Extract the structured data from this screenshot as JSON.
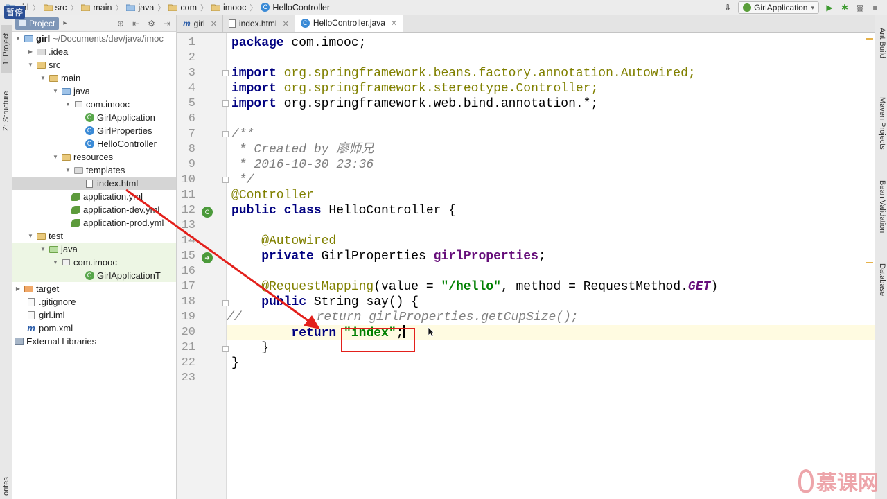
{
  "overlay": {
    "paused_label": "暂停"
  },
  "breadcrumb": [
    {
      "label": "girl"
    },
    {
      "label": "src"
    },
    {
      "label": "main"
    },
    {
      "label": "java"
    },
    {
      "label": "com"
    },
    {
      "label": "imooc"
    },
    {
      "label": "HelloController"
    }
  ],
  "toolbar": {
    "run_config": "GirlApplication"
  },
  "left_strip": {
    "project_tab": "1: Project",
    "structure_tab": "Z: Structure",
    "favorites_tab": "orites"
  },
  "project_panel": {
    "title": "Project",
    "tree": [
      {
        "label": "girl",
        "path": "~/Documents/dev/java/imoc"
      },
      {
        "label": ".idea"
      },
      {
        "label": "src"
      },
      {
        "label": "main"
      },
      {
        "label": "java"
      },
      {
        "label": "com.imooc"
      },
      {
        "label": "GirlApplication"
      },
      {
        "label": "GirlProperties"
      },
      {
        "label": "HelloController"
      },
      {
        "label": "resources"
      },
      {
        "label": "templates"
      },
      {
        "label": "index.html"
      },
      {
        "label": "application.yml"
      },
      {
        "label": "application-dev.yml"
      },
      {
        "label": "application-prod.yml"
      },
      {
        "label": "test"
      },
      {
        "label": "java"
      },
      {
        "label": "com.imooc"
      },
      {
        "label": "GirlApplicationT"
      },
      {
        "label": "target"
      },
      {
        "label": ".gitignore"
      },
      {
        "label": "girl.iml"
      },
      {
        "label": "pom.xml"
      },
      {
        "label": "External Libraries"
      }
    ]
  },
  "tabs": [
    {
      "label": "girl",
      "icon": "maven-icon"
    },
    {
      "label": "index.html",
      "icon": "html-file-icon"
    },
    {
      "label": "HelloController.java",
      "icon": "class-icon"
    }
  ],
  "editor": {
    "line_numbers": [
      "1",
      "2",
      "3",
      "4",
      "5",
      "6",
      "7",
      "8",
      "9",
      "10",
      "11",
      "12",
      "13",
      "14",
      "15",
      "16",
      "17",
      "18",
      "19",
      "20",
      "21",
      "22",
      "23"
    ],
    "code": {
      "l1_kw": "package",
      "l1_rest": " com.imooc;",
      "l3_kw": "import",
      "l3_rest": " org.springframework.beans.factory.annotation.Autowired;",
      "l4_kw": "import",
      "l4_rest": " org.springframework.stereotype.Controller;",
      "l5_kw": "import",
      "l5_rest": " org.springframework.web.bind.annotation.*;",
      "l7": "/**",
      "l8": " * Created by 廖师兄",
      "l9": " * 2016-10-30 23:36",
      "l10": " */",
      "l11": "@Controller",
      "l12_kw": "public class",
      "l12_rest": " HelloController {",
      "l14": "    @Autowired",
      "l15_kw": "    private",
      "l15_type": " GirlProperties ",
      "l15_field": "girlProperties",
      "l15_end": ";",
      "l17_ann": "    @RequestMapping",
      "l17_a": "(value = ",
      "l17_str": "\"/hello\"",
      "l17_b": ", method = RequestMethod.",
      "l17_get": "GET",
      "l17_c": ")",
      "l18_kw": "    public",
      "l18_rest": " String say() {",
      "l19": "//          return girlProperties.getCupSize();",
      "l20_kw": "        return",
      "l20_sp": " ",
      "l20_str": "\"index\"",
      "l20_end": ";",
      "l21": "    }",
      "l22": "}"
    }
  },
  "right_strip": {
    "ant": "Ant Build",
    "maven": "Maven Projects",
    "bean": "Bean Validation",
    "database": "Database"
  },
  "watermark": {
    "text": "慕课网"
  },
  "colors": {
    "keyword": "#000080",
    "annotation": "#808000",
    "string": "#008000",
    "comment": "#808080",
    "highlight": "#e3201b"
  }
}
